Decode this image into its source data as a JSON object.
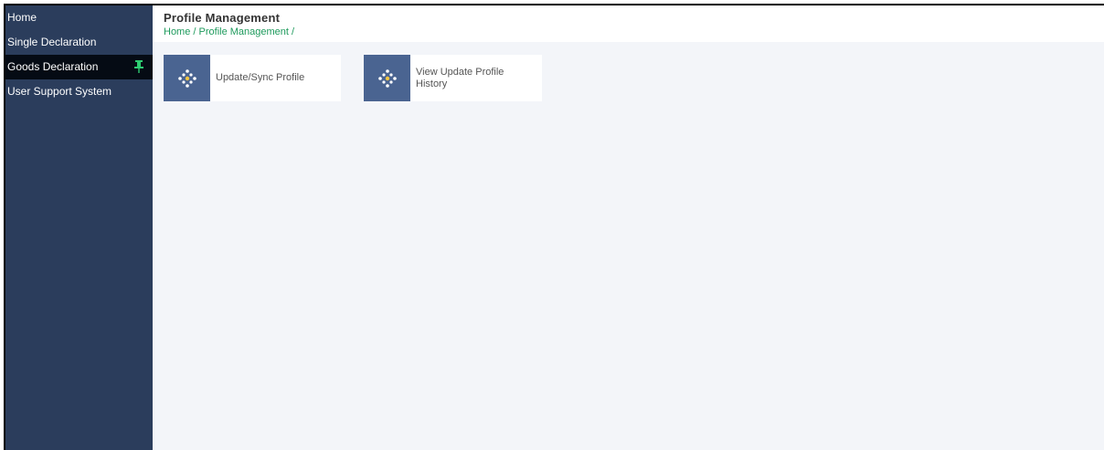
{
  "sidebar": {
    "items": [
      {
        "label": "Home"
      },
      {
        "label": "Single Declaration"
      },
      {
        "label": "Goods Declaration",
        "active": true,
        "icon": "pin-icon"
      },
      {
        "label": "User Support System"
      }
    ]
  },
  "header": {
    "title": "Profile Management",
    "breadcrumb": {
      "home": "Home",
      "sep1": " / ",
      "current": "Profile Management",
      "sep2": " /"
    }
  },
  "tiles": [
    {
      "label": "Update/Sync Profile",
      "icon": "diamond-dots-icon"
    },
    {
      "label_line1": "View Update Profile",
      "label_line2": "History",
      "icon": "diamond-dots-icon"
    }
  ],
  "colors": {
    "sidebar_bg": "#2b3d5c",
    "sidebar_active_bg": "#050b14",
    "pin_color": "#2ecc71",
    "breadcrumb": "#1e9a5c",
    "tile_icon_bg": "#4a6491",
    "content_bg": "#f3f5f9"
  }
}
